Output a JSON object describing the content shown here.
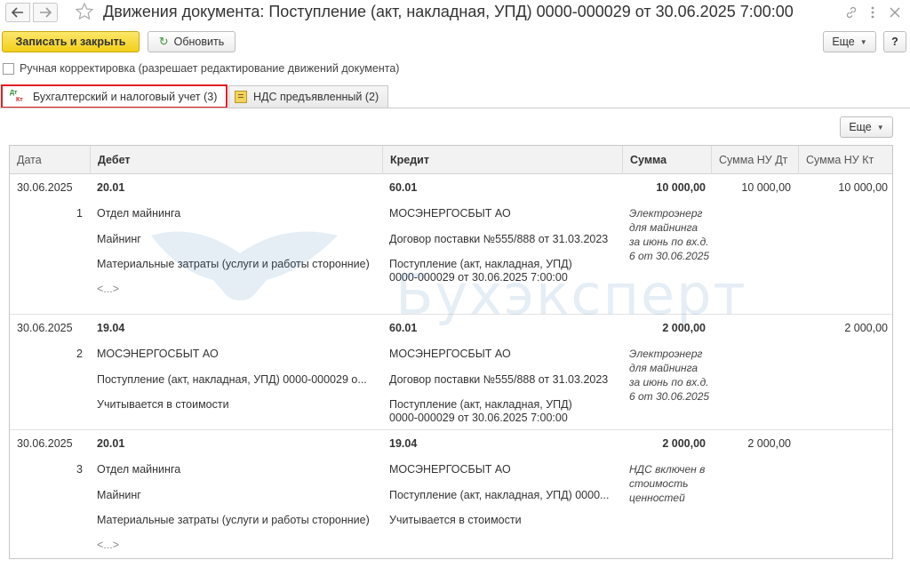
{
  "window": {
    "title": "Движения документа: Поступление (акт, накладная, УПД) 0000-000029 от 30.06.2025 7:00:00"
  },
  "toolbar": {
    "save_close_label": "Записать и закрыть",
    "refresh_label": "Обновить",
    "more_label": "Еще",
    "help_label": "?"
  },
  "manual_edit": {
    "label": "Ручная корректировка (разрешает редактирование движений документа)",
    "checked": false
  },
  "tabs": [
    {
      "label": "Бухгалтерский и налоговый учет (3)",
      "active": true,
      "icon_dt": "Дт",
      "icon_kt": "Кт"
    },
    {
      "label": "НДС предъявленный (2)",
      "active": false
    }
  ],
  "panel": {
    "more_label": "Еще"
  },
  "watermark": {
    "text": "Бухэксперт"
  },
  "table": {
    "columns": [
      "Дата",
      "Дебет",
      "Кредит",
      "Сумма",
      "Сумма НУ Дт",
      "Сумма НУ Кт"
    ],
    "rows": [
      {
        "date": "30.06.2025",
        "num": "1",
        "debit_account": "20.01",
        "debit_sub": [
          "Отдел майнинга",
          "Майнинг",
          "Материальные затраты (услуги и работы сторонние)",
          "<...>"
        ],
        "credit_account": "60.01",
        "credit_sub": [
          "МОСЭНЕРГОСБЫТ АО",
          "Договор поставки №555/888 от 31.03.2023",
          "Поступление (акт, накладная, УПД) 0000-000029 от 30.06.2025 7:00:00"
        ],
        "sum": "10 000,00",
        "content": "Электроэнерг для майнинга за июнь по вх.д. 6 от 30.06.2025",
        "nu_dt": "10 000,00",
        "nu_kt": "10 000,00"
      },
      {
        "date": "30.06.2025",
        "num": "2",
        "debit_account": "19.04",
        "debit_sub": [
          "МОСЭНЕРГОСБЫТ АО",
          "Поступление (акт, накладная, УПД) 0000-000029 о...",
          "Учитывается в стоимости"
        ],
        "credit_account": "60.01",
        "credit_sub": [
          "МОСЭНЕРГОСБЫТ АО",
          "Договор поставки №555/888 от 31.03.2023",
          "Поступление (акт, накладная, УПД) 0000-000029 от 30.06.2025 7:00:00"
        ],
        "sum": "2 000,00",
        "content": "Электроэнерг для майнинга за июнь по вх.д. 6 от 30.06.2025",
        "nu_dt": "",
        "nu_kt": "2 000,00"
      },
      {
        "date": "30.06.2025",
        "num": "3",
        "debit_account": "20.01",
        "debit_sub": [
          "Отдел майнинга",
          "Майнинг",
          "Материальные затраты (услуги и работы сторонние)",
          "<...>"
        ],
        "credit_account": "19.04",
        "credit_sub": [
          "МОСЭНЕРГОСБЫТ АО",
          "Поступление (акт, накладная, УПД) 0000...",
          "Учитывается в стоимости"
        ],
        "sum": "2 000,00",
        "content": "НДС включен в стоимость ценностей",
        "nu_dt": "2 000,00",
        "nu_kt": ""
      }
    ]
  }
}
